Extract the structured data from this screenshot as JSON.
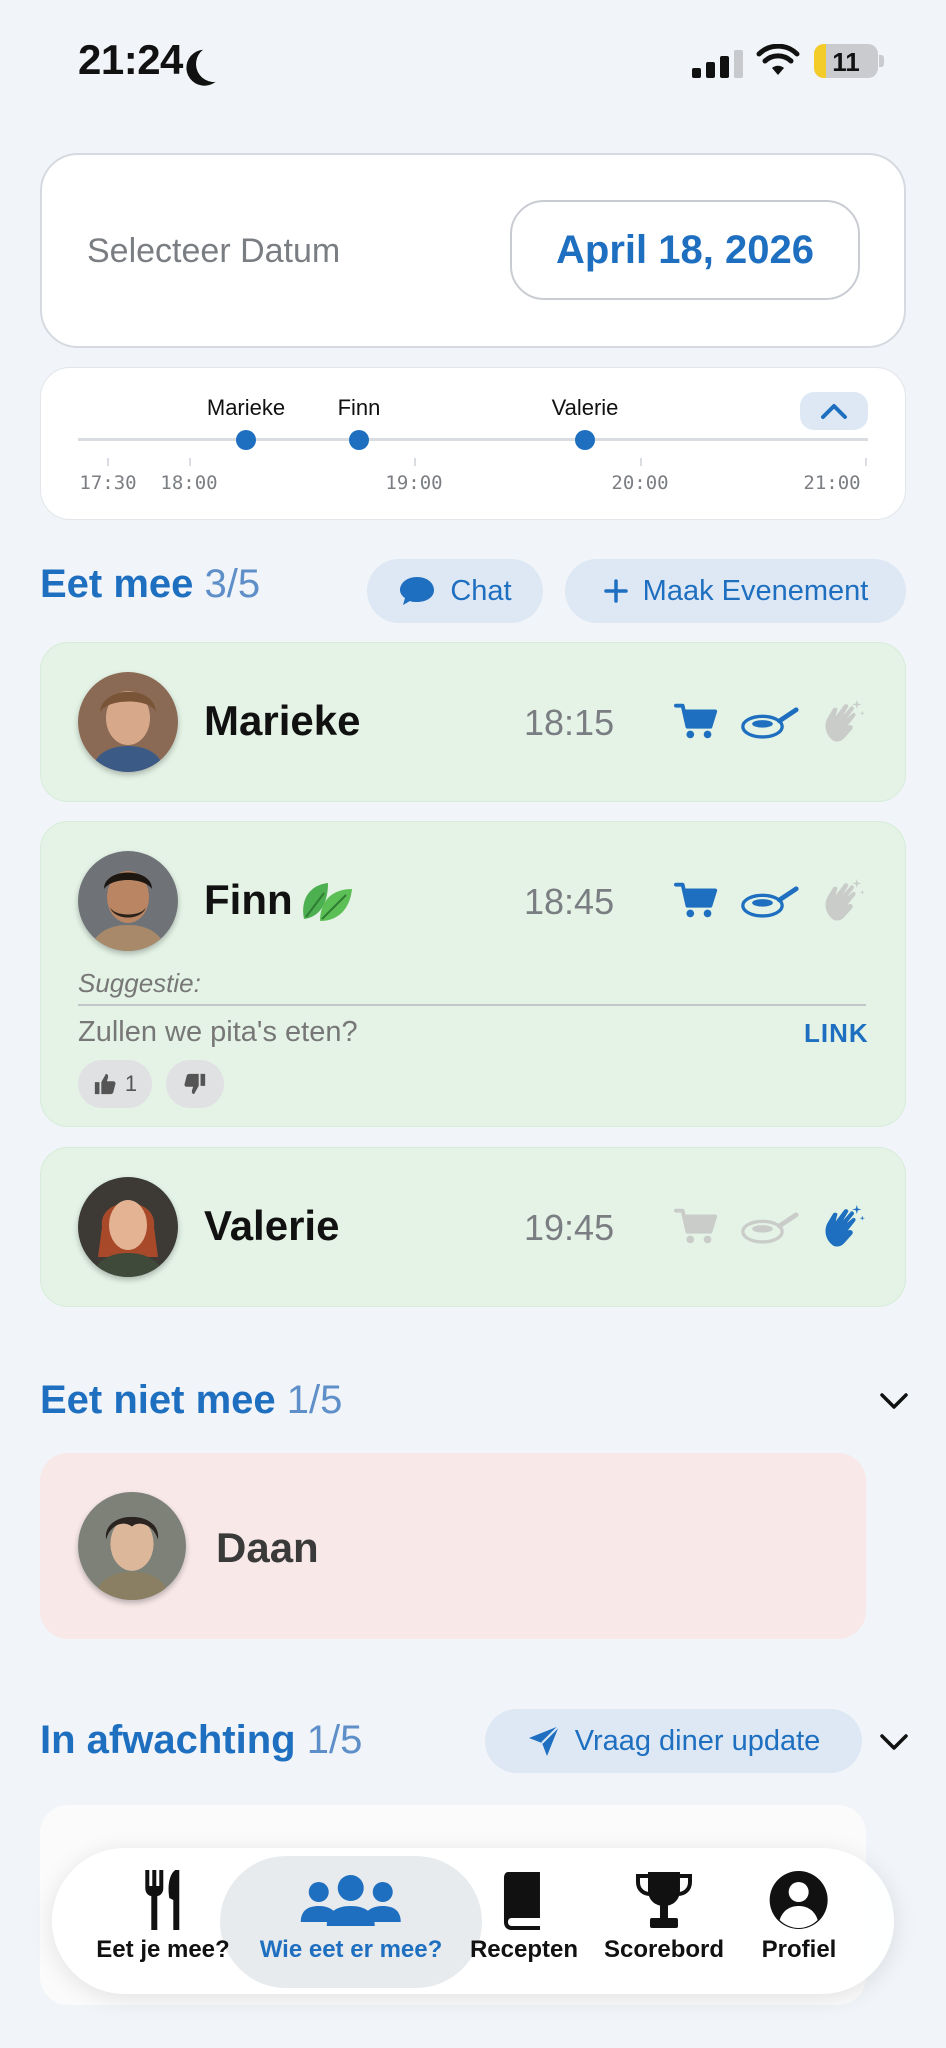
{
  "status_bar": {
    "time": "21:24",
    "battery": "11"
  },
  "date_selector": {
    "label": "Selecteer Datum",
    "value": "April 18, 2026"
  },
  "timeline": {
    "markers": [
      {
        "name": "Marieke",
        "time": "18:15"
      },
      {
        "name": "Finn",
        "time": "18:45"
      },
      {
        "name": "Valerie",
        "time": "19:45"
      }
    ],
    "ticks": [
      "17:30",
      "18:00",
      "19:00",
      "20:00",
      "21:00"
    ]
  },
  "eating": {
    "title": "Eet mee",
    "count": "3/5",
    "chat_label": "Chat",
    "event_label": "Maak Evenement",
    "people": [
      {
        "name": "Marieke",
        "time": "18:15",
        "shopping": true,
        "cooking": true,
        "dishes": false
      },
      {
        "name": "Finn",
        "time": "18:45",
        "shopping": true,
        "cooking": true,
        "dishes": false,
        "vegetarian": true,
        "suggestion_label": "Suggestie:",
        "suggestion": "Zullen we pita's eten?",
        "link": "LINK",
        "upvotes": "1"
      },
      {
        "name": "Valerie",
        "time": "19:45",
        "shopping": false,
        "cooking": false,
        "dishes": true
      }
    ]
  },
  "not_eating": {
    "title": "Eet niet mee",
    "count": "1/5",
    "people": [
      {
        "name": "Daan"
      }
    ]
  },
  "pending": {
    "title": "In afwachting",
    "count": "1/5",
    "update_label": "Vraag diner update"
  },
  "tabs": [
    {
      "label": "Eet je mee?",
      "icon": "cutlery-icon"
    },
    {
      "label": "Wie eet er mee?",
      "icon": "people-icon",
      "active": true
    },
    {
      "label": "Recepten",
      "icon": "book-icon"
    },
    {
      "label": "Scorebord",
      "icon": "trophy-icon"
    },
    {
      "label": "Profiel",
      "icon": "profile-icon"
    }
  ],
  "colors": {
    "accent": "#1e6fc0",
    "eat_card": "#e4f3e6",
    "not_eat_card": "#f8e8e8",
    "background": "#f1f4f8"
  }
}
